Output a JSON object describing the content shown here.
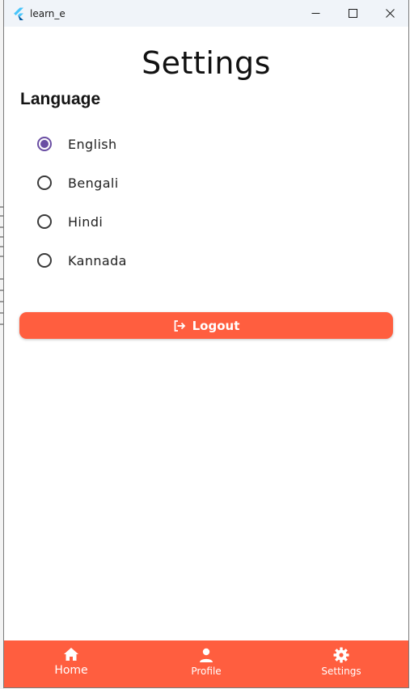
{
  "window": {
    "title": "learn_e",
    "controls": [
      "minimize-icon",
      "maximize-icon",
      "close-icon"
    ]
  },
  "page": {
    "title": "Settings"
  },
  "language_section": {
    "heading": "Language",
    "options": [
      {
        "label": "English",
        "selected": true
      },
      {
        "label": "Bengali",
        "selected": false
      },
      {
        "label": "Hindi",
        "selected": false
      },
      {
        "label": "Kannada",
        "selected": false
      }
    ]
  },
  "logout": {
    "label": "Logout",
    "icon": "logout-icon"
  },
  "bottom_nav": {
    "items": [
      {
        "label": "Home",
        "icon": "home-icon",
        "active": true
      },
      {
        "label": "Profile",
        "icon": "person-icon",
        "active": false
      },
      {
        "label": "Settings",
        "icon": "gear-icon",
        "active": false
      }
    ]
  },
  "colors": {
    "accent": "#ff5e3f",
    "radio_selected": "#6a4ea3",
    "titlebar": "#f0f4f9"
  }
}
